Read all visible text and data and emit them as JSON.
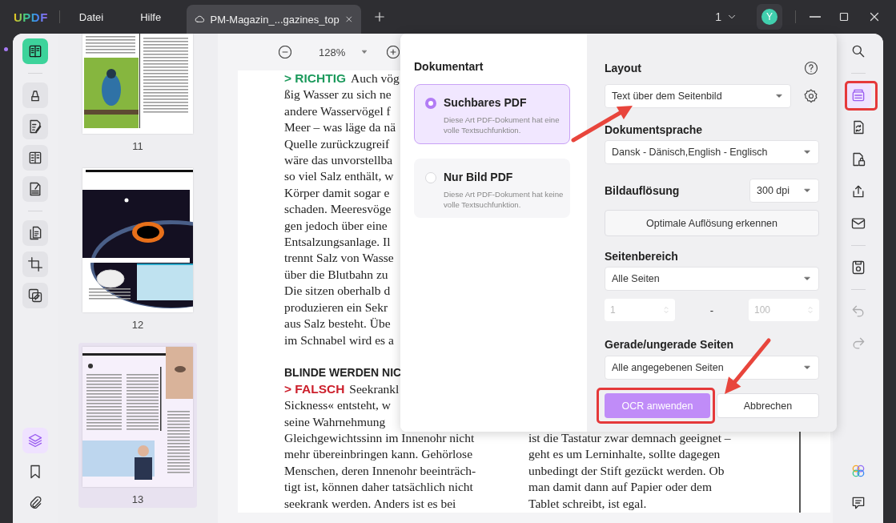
{
  "titlebar": {
    "logo": "UPDF",
    "menu": [
      "Datei",
      "Hilfe"
    ],
    "tab": {
      "title": "PM-Magazin_...gazines_top"
    },
    "window_count": "1",
    "avatar": "Y"
  },
  "left_tools": {
    "groups": [
      [
        {
          "kind": "reader",
          "selected": true
        }
      ],
      [
        {
          "kind": "comment",
          "selected": false
        },
        {
          "kind": "edit",
          "selected": false
        },
        {
          "kind": "form",
          "selected": false
        },
        {
          "kind": "fill-sign",
          "selected": false
        }
      ],
      [
        {
          "kind": "organize",
          "selected": false
        },
        {
          "kind": "crop",
          "selected": false
        },
        {
          "kind": "watermark",
          "selected": false
        }
      ]
    ],
    "bottom": [
      {
        "kind": "layers",
        "selected": true
      },
      {
        "kind": "bookmark",
        "selected": false
      },
      {
        "kind": "attachment",
        "selected": false
      }
    ]
  },
  "thumbnails": [
    {
      "page": "11",
      "selected": false
    },
    {
      "page": "12",
      "selected": false
    },
    {
      "page": "13",
      "selected": true
    }
  ],
  "zoom": {
    "value": "128%"
  },
  "document": {
    "left_column": [
      {
        "kind": "verdict",
        "label": "> RICHTIG",
        "color": "#1c9a5c",
        "text": "Auch vög"
      },
      {
        "kind": "text",
        "text": "ßig Wasser zu sich ne"
      },
      {
        "kind": "text",
        "text": "andere Wasservögel f"
      },
      {
        "kind": "text",
        "text": "Meer – was läge da nä"
      },
      {
        "kind": "text",
        "text": "Quelle zurückzugreif"
      },
      {
        "kind": "text",
        "text": "wäre das unvorstellba"
      },
      {
        "kind": "text",
        "text": "so viel Salz enthält, w"
      },
      {
        "kind": "text",
        "text": "Körper damit sogar e"
      },
      {
        "kind": "text",
        "text": "schaden. Meeresvöge"
      },
      {
        "kind": "text",
        "text": "gen jedoch über eine"
      },
      {
        "kind": "text",
        "text": "Entsalzungsanlage. Il"
      },
      {
        "kind": "text",
        "text": "trennt Salz von Wasse"
      },
      {
        "kind": "text",
        "text": "über die Blutbahn zu"
      },
      {
        "kind": "text",
        "text": "Die sitzen oberhalb d"
      },
      {
        "kind": "text",
        "text": "produzieren ein Sekr"
      },
      {
        "kind": "text",
        "text": "aus Salz besteht. Übe"
      },
      {
        "kind": "text",
        "text": "im Schnabel wird es a"
      },
      {
        "kind": "heading",
        "text": "BLINDE WERDEN NIC"
      },
      {
        "kind": "verdict",
        "label": "> FALSCH",
        "color": "#cc1f2b",
        "text": "Seekrankl"
      },
      {
        "kind": "text",
        "text": "Sickness« entsteht, w"
      },
      {
        "kind": "text",
        "text": "seine Wahrnehmung"
      },
      {
        "kind": "text",
        "text": "Gleichgewichtssinn im Innenohr nicht"
      },
      {
        "kind": "text",
        "text": "mehr übereinbringen kann. Gehörlose"
      },
      {
        "kind": "text",
        "text": "Menschen, deren Innenohr beeinträch-"
      },
      {
        "kind": "text",
        "text": "tigt ist, können daher tatsächlich nicht"
      },
      {
        "kind": "text",
        "text": "seekrank werden. Anders ist es bei"
      }
    ],
    "right_column": [
      {
        "kind": "text",
        "text": "ist die Tastatur zwar demnach geeignet –"
      },
      {
        "kind": "text",
        "text": "geht es um Lerninhalte, sollte dagegen"
      },
      {
        "kind": "text",
        "text": "unbedingt der Stift gezückt werden. Ob"
      },
      {
        "kind": "text",
        "text": "man damit dann auf Papier oder dem"
      },
      {
        "kind": "text",
        "text": "Tablet schreibt, ist egal."
      }
    ]
  },
  "dialog": {
    "doc_type_title": "Dokumentart",
    "options": [
      {
        "title": "Suchbares PDF",
        "description": "Diese Art PDF-Dokument hat eine volle Textsuchfunktion.",
        "selected": true
      },
      {
        "title": "Nur Bild PDF",
        "description": "Diese Art PDF-Dokument hat keine volle Textsuchfunktion.",
        "selected": false
      }
    ],
    "layout": {
      "label": "Layout",
      "value": "Text über dem Seitenbild"
    },
    "language": {
      "label": "Dokumentsprache",
      "value": "Dansk - Dänisch,English - Englisch"
    },
    "resolution": {
      "label": "Bildauflösung",
      "value": "300 dpi"
    },
    "detect_button": "Optimale Auflösung erkennen",
    "page_range": {
      "label": "Seitenbereich",
      "value": "Alle Seiten",
      "from": "1",
      "separator": "-",
      "to": "100",
      "disabled": true
    },
    "parity": {
      "label": "Gerade/ungerade Seiten",
      "value": "Alle angegebenen Seiten"
    },
    "apply_button": "OCR anwenden",
    "cancel_button": "Abbrechen"
  },
  "right_tools": {
    "groups": [
      [
        {
          "kind": "search",
          "selected": false,
          "disabled": false
        }
      ],
      [
        {
          "kind": "ocr",
          "selected": true,
          "disabled": false
        },
        {
          "kind": "convert",
          "selected": false,
          "disabled": false
        },
        {
          "kind": "protect",
          "selected": false,
          "disabled": false
        },
        {
          "kind": "share",
          "selected": false,
          "disabled": false
        },
        {
          "kind": "mail",
          "selected": false,
          "disabled": false
        }
      ],
      [
        {
          "kind": "save",
          "selected": false,
          "disabled": false
        }
      ],
      [
        {
          "kind": "undo",
          "selected": false,
          "disabled": true
        },
        {
          "kind": "redo",
          "selected": false,
          "disabled": true
        }
      ]
    ],
    "bottom": [
      {
        "kind": "ai",
        "selected": false,
        "disabled": false
      },
      {
        "kind": "comment-panel",
        "selected": false,
        "disabled": false
      }
    ]
  }
}
